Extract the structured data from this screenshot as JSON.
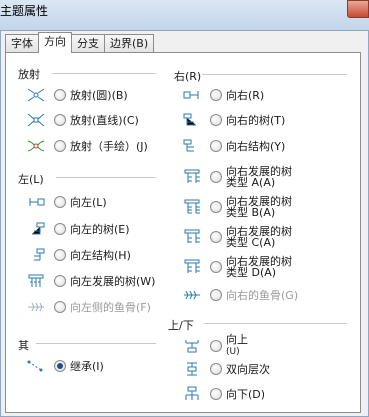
{
  "window": {
    "title": "主题属性"
  },
  "tabs": [
    {
      "label": "字体"
    },
    {
      "label": "方向"
    },
    {
      "label": "分支"
    },
    {
      "label": "边界(B)"
    }
  ],
  "sections": {
    "radial": {
      "header": "放射",
      "options": [
        {
          "label": "放射(圆)(B)",
          "icon": "radial-circle-icon"
        },
        {
          "label": "放射(直线)(C)",
          "icon": "radial-line-icon"
        },
        {
          "label": "放射（手绘）(J)",
          "icon": "radial-hand-icon"
        }
      ]
    },
    "right": {
      "header": "右(R)",
      "options": [
        {
          "label": "向右(R)",
          "icon": "right-icon"
        },
        {
          "label": "向右的树(T)",
          "icon": "right-tree-icon"
        },
        {
          "label": "向右结构(Y)",
          "icon": "right-structure-icon"
        },
        {
          "label": [
            "向右发展的树",
            "类型 A(A)"
          ],
          "icon": "right-tree-a-icon"
        },
        {
          "label": [
            "向右发展的树",
            "类型 B(A)"
          ],
          "icon": "right-tree-b-icon"
        },
        {
          "label": [
            "向右发展的树",
            "类型 C(A)"
          ],
          "icon": "right-tree-c-icon"
        },
        {
          "label": [
            "向右发展的树",
            "类型 D(A)"
          ],
          "icon": "right-tree-d-icon"
        },
        {
          "label": "向右的鱼骨(G)",
          "icon": "right-fishbone-icon",
          "disabled": true
        }
      ]
    },
    "left": {
      "header": "左(L)",
      "options": [
        {
          "label": "向左(L)",
          "icon": "left-icon"
        },
        {
          "label": "向左的树(E)",
          "icon": "left-tree-icon"
        },
        {
          "label": "向左结构(H)",
          "icon": "left-structure-icon"
        },
        {
          "label": "向左发展的树(W)",
          "icon": "left-tree-grow-icon"
        },
        {
          "label": "向左侧的鱼骨(F)",
          "icon": "left-fishbone-icon",
          "disabled": true
        }
      ]
    },
    "updown": {
      "header": "上/下",
      "options": [
        {
          "label": [
            "向上",
            "(U)"
          ],
          "icon": "up-icon"
        },
        {
          "label": "双向层次",
          "icon": "updown-hierarchy-icon"
        },
        {
          "label": "向下(D)",
          "icon": "down-icon"
        }
      ]
    },
    "other": {
      "header": "其",
      "options": [
        {
          "label": "继承(I)",
          "icon": "inherit-icon",
          "selected": true
        }
      ]
    }
  }
}
